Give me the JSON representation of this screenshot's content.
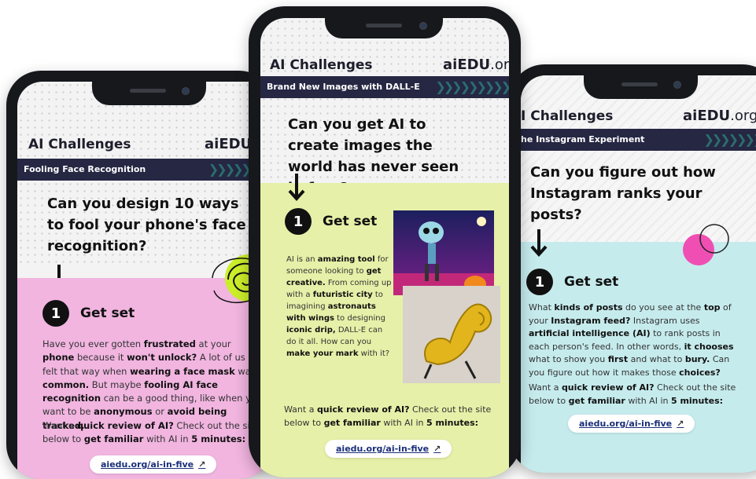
{
  "phones": {
    "left": {
      "app_title": "AI Challenges",
      "logo_bold": "aiEDU",
      "logo_light": "",
      "banner": "Fooling Face Recognition",
      "question": "Can you design 10 ways to fool your phone's face recognition?",
      "step_number": "1",
      "step_label": "Get set",
      "paragraph_1": [
        {
          "t": "Have you ever gotten "
        },
        {
          "t": "frustrated",
          "b": true
        },
        {
          "t": " at your "
        },
        {
          "t": "phone",
          "b": true
        },
        {
          "t": " because it "
        },
        {
          "t": "won't unlock?",
          "b": true
        },
        {
          "t": " A lot of us felt that way when "
        },
        {
          "t": "wearing a face mask",
          "b": true
        },
        {
          "t": " was "
        },
        {
          "t": "common.",
          "b": true
        },
        {
          "t": " But maybe "
        },
        {
          "t": "fooling AI face recognition",
          "b": true
        },
        {
          "t": " can be a good thing, like when you want to be "
        },
        {
          "t": "anonymous",
          "b": true
        },
        {
          "t": " or "
        },
        {
          "t": "avoid being tracked.",
          "b": true
        }
      ],
      "paragraph_2": [
        {
          "t": "Want a "
        },
        {
          "t": "quick review of AI?",
          "b": true
        },
        {
          "t": " Check out the site below to "
        },
        {
          "t": "get familiar",
          "b": true
        },
        {
          "t": " with AI in "
        },
        {
          "t": "5 minutes:",
          "b": true
        }
      ],
      "link_text": "aiedu.org/ai-in-five"
    },
    "center": {
      "app_title": "AI Challenges",
      "logo_bold": "aiEDU",
      "logo_light": ".org",
      "banner": "Brand New Images with DALL-E",
      "question": "Can you get AI to create images the world has never seen before?",
      "step_number": "1",
      "step_label": "Get set",
      "paragraph_1": [
        {
          "t": "AI is an "
        },
        {
          "t": "amazing tool",
          "b": true
        },
        {
          "t": " for someone looking to "
        },
        {
          "t": "get creative.",
          "b": true
        },
        {
          "t": " From coming up with a "
        },
        {
          "t": "futuristic city",
          "b": true
        },
        {
          "t": " to imagining "
        },
        {
          "t": "astronauts with wings",
          "b": true
        },
        {
          "t": " to designing "
        },
        {
          "t": "iconic drip,",
          "b": true
        },
        {
          "t": " DALL-E can do it all. How can you "
        },
        {
          "t": "make your mark",
          "b": true
        },
        {
          "t": " with it?"
        }
      ],
      "paragraph_2": [
        {
          "t": "Want a "
        },
        {
          "t": "quick review of AI?",
          "b": true
        },
        {
          "t": " Check out the site below to "
        },
        {
          "t": "get familiar",
          "b": true
        },
        {
          "t": " with AI in "
        },
        {
          "t": "5 minutes:",
          "b": true
        }
      ],
      "link_text": "aiedu.org/ai-in-five"
    },
    "right": {
      "app_title": "I Challenges",
      "logo_bold": "aiEDU",
      "logo_light": ".org",
      "banner": "he Instagram Experiment",
      "question": "Can you figure out how Instagram ranks your posts?",
      "step_number": "1",
      "step_label": "Get set",
      "paragraph_1": [
        {
          "t": "What "
        },
        {
          "t": "kinds of posts",
          "b": true
        },
        {
          "t": " do you see at the "
        },
        {
          "t": "top",
          "b": true
        },
        {
          "t": " of your "
        },
        {
          "t": "Instagram feed?",
          "b": true
        },
        {
          "t": " Instagram uses "
        },
        {
          "t": "artificial intelligence (AI)",
          "b": true
        },
        {
          "t": " to rank posts in each person's feed. In other words, "
        },
        {
          "t": "it chooses",
          "b": true
        },
        {
          "t": " what to show you "
        },
        {
          "t": "first",
          "b": true
        },
        {
          "t": " and what to "
        },
        {
          "t": "bury.",
          "b": true
        },
        {
          "t": " Can you figure out how it makes those "
        },
        {
          "t": "choices?",
          "b": true
        }
      ],
      "paragraph_2": [
        {
          "t": "Want a "
        },
        {
          "t": "quick review of AI?",
          "b": true
        },
        {
          "t": " Check out the site below to "
        },
        {
          "t": "get familiar",
          "b": true
        },
        {
          "t": " with AI in "
        },
        {
          "t": "5 minutes:",
          "b": true
        }
      ],
      "link_text": "aiedu.org/ai-in-five"
    }
  },
  "colors": {
    "left_panel": "#f1b5e0",
    "center_panel": "#e6f0a8",
    "right_panel": "#c6ebed",
    "banner": "#252743",
    "accent_chevrons": "#2b6d6e"
  },
  "icons": [
    "down-arrow-icon",
    "external-link-icon",
    "scribble-circle-icon",
    "pink-dot-icon"
  ]
}
